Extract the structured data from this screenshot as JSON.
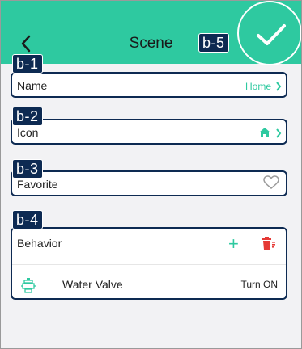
{
  "header": {
    "title": "Scene",
    "back_icon": "chevron-left-icon"
  },
  "tags": {
    "b1": "b-1",
    "b2": "b-2",
    "b3": "b-3",
    "b4": "b-4",
    "b5": "b-5"
  },
  "rows": {
    "name": {
      "label": "Name",
      "value": "Home"
    },
    "icon": {
      "label": "Icon",
      "value_icon": "home-icon"
    },
    "favorite": {
      "label": "Favorite",
      "value_icon": "heart-outline-icon"
    }
  },
  "behavior": {
    "title": "Behavior",
    "add_icon": "plus-icon",
    "delete_icon": "trash-icon",
    "items": [
      {
        "icon": "water-valve-icon",
        "name": "Water Valve",
        "action": "Turn ON"
      }
    ]
  },
  "confirm": {
    "icon": "checkmark-icon"
  },
  "colors": {
    "accent": "#2ec9a0",
    "tag": "#0d2a52",
    "danger": "#e53935"
  }
}
